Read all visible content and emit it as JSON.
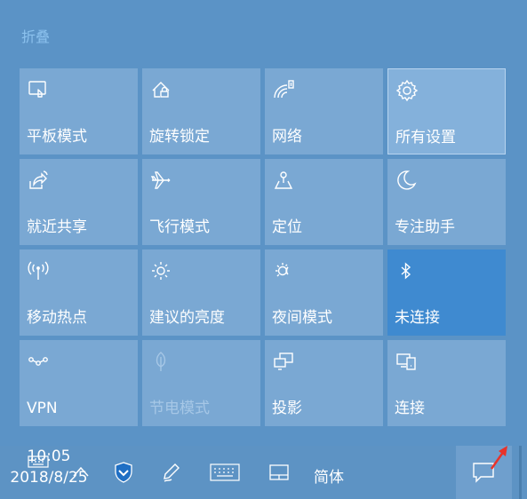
{
  "panel": {
    "collapse_label": "折叠"
  },
  "tiles": [
    {
      "label": "平板模式",
      "icon": "tablet-mode-icon"
    },
    {
      "label": "旋转锁定",
      "icon": "rotation-lock-icon"
    },
    {
      "label": "网络",
      "icon": "network-icon"
    },
    {
      "label": "所有设置",
      "icon": "gear-icon"
    },
    {
      "label": "就近共享",
      "icon": "nearby-share-icon"
    },
    {
      "label": "飞行模式",
      "icon": "airplane-icon"
    },
    {
      "label": "定位",
      "icon": "location-icon"
    },
    {
      "label": "专注助手",
      "icon": "moon-icon"
    },
    {
      "label": "移动热点",
      "icon": "hotspot-icon"
    },
    {
      "label": "建议的亮度",
      "icon": "brightness-icon"
    },
    {
      "label": "夜间模式",
      "icon": "night-light-icon"
    },
    {
      "label": "未连接",
      "icon": "bluetooth-icon"
    },
    {
      "label": "VPN",
      "icon": "vpn-icon"
    },
    {
      "label": "节电模式",
      "icon": "battery-saver-icon"
    },
    {
      "label": "投影",
      "icon": "project-icon"
    },
    {
      "label": "连接",
      "icon": "connect-icon"
    }
  ],
  "taskbar": {
    "ime_label": "简体",
    "time": "10:05",
    "date": "2018/8/25"
  },
  "colors": {
    "background": "#5b93c6",
    "tile": "#7aa8d3",
    "tile_active": "#3f8ad0",
    "accent_arrow": "#e8332a"
  }
}
